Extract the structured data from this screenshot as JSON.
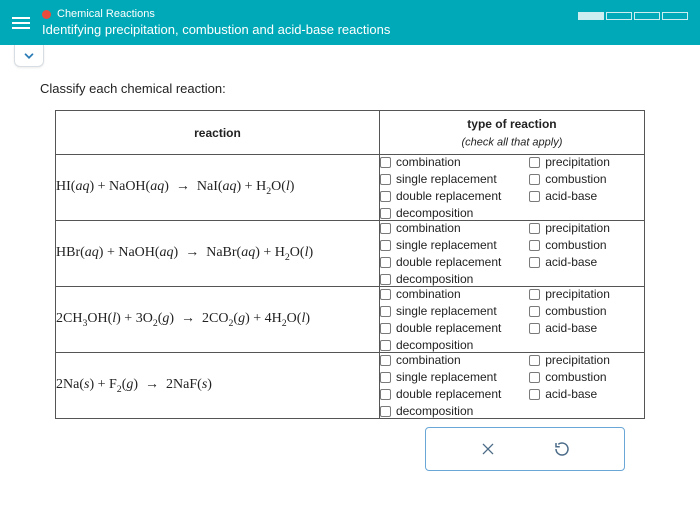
{
  "header": {
    "crumb": "Chemical Reactions",
    "title": "Identifying precipitation, combustion and acid-base reactions"
  },
  "prompt": "Classify each chemical reaction:",
  "table": {
    "col_reaction": "reaction",
    "col_type": "type of reaction",
    "col_type_sub": "(check all that apply)"
  },
  "options": {
    "combination": "combination",
    "single_replacement": "single replacement",
    "double_replacement": "double replacement",
    "decomposition": "decomposition",
    "precipitation": "precipitation",
    "combustion": "combustion",
    "acid_base": "acid-base"
  },
  "reactions": [
    "HI(aq) + NaOH(aq) → NaI(aq) + H₂O(l)",
    "HBr(aq) + NaOH(aq) → NaBr(aq) + H₂O(l)",
    "2CH₃OH(l) + 3O₂(g) → 2CO₂(g) + 4H₂O(l)",
    "2Na(s) + F₂(g) → 2NaF(s)"
  ],
  "chart_data": {
    "type": "table",
    "title": "Classify each chemical reaction",
    "columns": [
      "reaction",
      "combination",
      "single replacement",
      "double replacement",
      "decomposition",
      "precipitation",
      "combustion",
      "acid-base"
    ],
    "rows": [
      {
        "reaction": "HI(aq) + NaOH(aq) → NaI(aq) + H2O(l)",
        "combination": false,
        "single replacement": false,
        "double replacement": false,
        "decomposition": false,
        "precipitation": false,
        "combustion": false,
        "acid-base": false
      },
      {
        "reaction": "HBr(aq) + NaOH(aq) → NaBr(aq) + H2O(l)",
        "combination": false,
        "single replacement": false,
        "double replacement": false,
        "decomposition": false,
        "precipitation": false,
        "combustion": false,
        "acid-base": false
      },
      {
        "reaction": "2CH3OH(l) + 3O2(g) → 2CO2(g) + 4H2O(l)",
        "combination": false,
        "single replacement": false,
        "double replacement": false,
        "decomposition": false,
        "precipitation": false,
        "combustion": false,
        "acid-base": false
      },
      {
        "reaction": "2Na(s) + F2(g) → 2NaF(s)",
        "combination": false,
        "single replacement": false,
        "double replacement": false,
        "decomposition": false,
        "precipitation": false,
        "combustion": false,
        "acid-base": false
      }
    ]
  }
}
